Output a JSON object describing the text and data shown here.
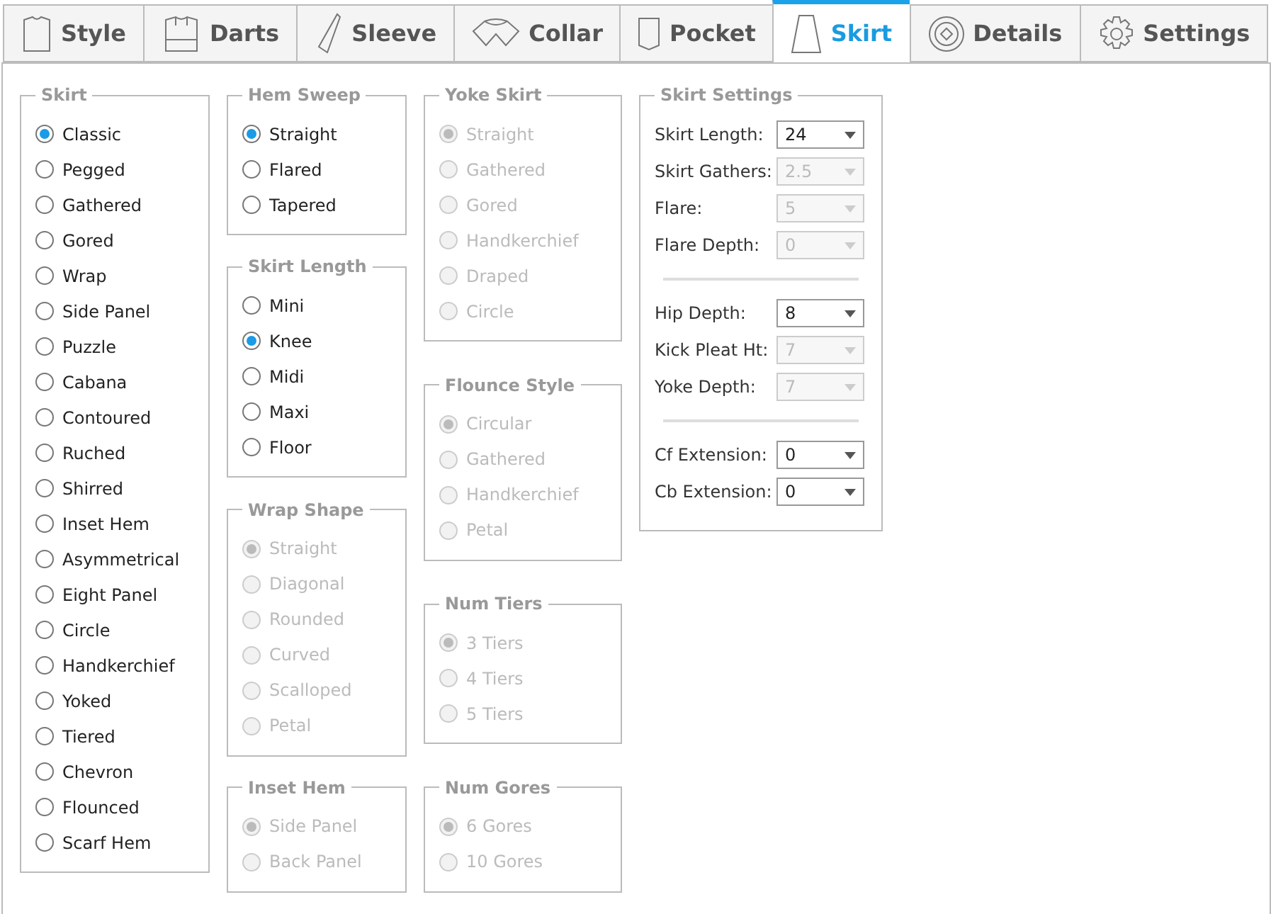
{
  "tabs": [
    {
      "label": "Style",
      "selected": false
    },
    {
      "label": "Darts",
      "selected": false
    },
    {
      "label": "Sleeve",
      "selected": false
    },
    {
      "label": "Collar",
      "selected": false
    },
    {
      "label": "Pocket",
      "selected": false
    },
    {
      "label": "Skirt",
      "selected": true
    },
    {
      "label": "Details",
      "selected": false
    },
    {
      "label": "Settings",
      "selected": false
    }
  ],
  "columns": [
    [
      {
        "title": "Skirt",
        "disabled": false,
        "options": [
          {
            "label": "Classic",
            "selected": true
          },
          {
            "label": "Pegged",
            "selected": false
          },
          {
            "label": "Gathered",
            "selected": false
          },
          {
            "label": "Gored",
            "selected": false
          },
          {
            "label": "Wrap",
            "selected": false
          },
          {
            "label": "Side Panel",
            "selected": false
          },
          {
            "label": "Puzzle",
            "selected": false
          },
          {
            "label": "Cabana",
            "selected": false
          },
          {
            "label": "Contoured",
            "selected": false
          },
          {
            "label": "Ruched",
            "selected": false
          },
          {
            "label": "Shirred",
            "selected": false
          },
          {
            "label": "Inset Hem",
            "selected": false
          },
          {
            "label": "Asymmetrical",
            "selected": false
          },
          {
            "label": "Eight Panel",
            "selected": false
          },
          {
            "label": "Circle",
            "selected": false
          },
          {
            "label": "Handkerchief",
            "selected": false
          },
          {
            "label": "Yoked",
            "selected": false
          },
          {
            "label": "Tiered",
            "selected": false
          },
          {
            "label": "Chevron",
            "selected": false
          },
          {
            "label": "Flounced",
            "selected": false
          },
          {
            "label": "Scarf Hem",
            "selected": false
          }
        ]
      }
    ],
    [
      {
        "title": "Hem Sweep",
        "disabled": false,
        "options": [
          {
            "label": "Straight",
            "selected": true
          },
          {
            "label": "Flared",
            "selected": false
          },
          {
            "label": "Tapered",
            "selected": false
          }
        ]
      },
      {
        "title": "Skirt Length",
        "disabled": false,
        "options": [
          {
            "label": "Mini",
            "selected": false
          },
          {
            "label": "Knee",
            "selected": true
          },
          {
            "label": "Midi",
            "selected": false
          },
          {
            "label": "Maxi",
            "selected": false
          },
          {
            "label": "Floor",
            "selected": false
          }
        ]
      },
      {
        "title": "Wrap Shape",
        "disabled": true,
        "options": [
          {
            "label": "Straight",
            "selected": true
          },
          {
            "label": "Diagonal",
            "selected": false
          },
          {
            "label": "Rounded",
            "selected": false
          },
          {
            "label": "Curved",
            "selected": false
          },
          {
            "label": "Scalloped",
            "selected": false
          },
          {
            "label": "Petal",
            "selected": false
          }
        ]
      },
      {
        "title": "Inset Hem",
        "disabled": true,
        "options": [
          {
            "label": "Side Panel",
            "selected": true
          },
          {
            "label": "Back Panel",
            "selected": false
          }
        ]
      }
    ],
    [
      {
        "title": "Yoke Skirt",
        "disabled": true,
        "options": [
          {
            "label": "Straight",
            "selected": true
          },
          {
            "label": "Gathered",
            "selected": false
          },
          {
            "label": "Gored",
            "selected": false
          },
          {
            "label": "Handkerchief",
            "selected": false
          },
          {
            "label": "Draped",
            "selected": false
          },
          {
            "label": "Circle",
            "selected": false
          }
        ]
      },
      {
        "title": "Flounce Style",
        "disabled": true,
        "options": [
          {
            "label": "Circular",
            "selected": true
          },
          {
            "label": "Gathered",
            "selected": false
          },
          {
            "label": "Handkerchief",
            "selected": false
          },
          {
            "label": "Petal",
            "selected": false
          }
        ]
      },
      {
        "title": "Num Tiers",
        "disabled": true,
        "options": [
          {
            "label": "3 Tiers",
            "selected": true
          },
          {
            "label": "4 Tiers",
            "selected": false
          },
          {
            "label": "5 Tiers",
            "selected": false
          }
        ]
      },
      {
        "title": "Num Gores",
        "disabled": true,
        "options": [
          {
            "label": "6 Gores",
            "selected": true
          },
          {
            "label": "10 Gores",
            "selected": false
          }
        ]
      }
    ]
  ],
  "settings": {
    "title": "Skirt Settings",
    "sections": [
      [
        {
          "label": "Skirt Length:",
          "value": "24",
          "disabled": false
        },
        {
          "label": "Skirt Gathers:",
          "value": "2.5",
          "disabled": true
        },
        {
          "label": "Flare:",
          "value": "5",
          "disabled": true
        },
        {
          "label": "Flare Depth:",
          "value": "0",
          "disabled": true
        }
      ],
      [
        {
          "label": "Hip Depth:",
          "value": "8",
          "disabled": false
        },
        {
          "label": "Kick Pleat Ht:",
          "value": "7",
          "disabled": true
        },
        {
          "label": "Yoke Depth:",
          "value": "7",
          "disabled": true
        }
      ],
      [
        {
          "label": "Cf Extension:",
          "value": "0",
          "disabled": false
        },
        {
          "label": "Cb Extension:",
          "value": "0",
          "disabled": false
        }
      ]
    ]
  }
}
